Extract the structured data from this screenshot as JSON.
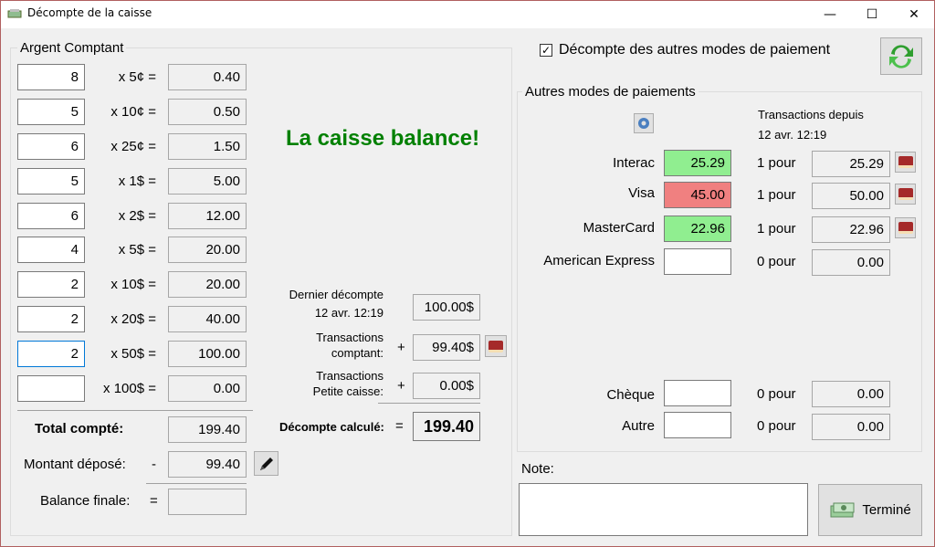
{
  "window": {
    "title": "Décompte de la caisse",
    "min_glyph": "—",
    "max_glyph": "☐",
    "close_glyph": "✕"
  },
  "cash": {
    "legend": "Argent Comptant",
    "rows": [
      {
        "qty": "8",
        "label": "x 5¢ =",
        "amount": "0.40"
      },
      {
        "qty": "5",
        "label": "x 10¢ =",
        "amount": "0.50"
      },
      {
        "qty": "6",
        "label": "x 25¢ =",
        "amount": "1.50"
      },
      {
        "qty": "5",
        "label": "x 1$ =",
        "amount": "5.00"
      },
      {
        "qty": "6",
        "label": "x 2$ =",
        "amount": "12.00"
      },
      {
        "qty": "4",
        "label": "x 5$ =",
        "amount": "20.00"
      },
      {
        "qty": "2",
        "label": "x 10$ =",
        "amount": "20.00"
      },
      {
        "qty": "2",
        "label": "x 20$ =",
        "amount": "40.00"
      },
      {
        "qty": "2",
        "label": "x 50$ =",
        "amount": "100.00"
      },
      {
        "qty": "",
        "label": "x 100$ =",
        "amount": "0.00"
      }
    ],
    "total_label": "Total compté:",
    "total_value": "199.40",
    "deposit_label": "Montant déposé:",
    "deposit_sign": "-",
    "deposit_value": "99.40",
    "final_label": "Balance finale:",
    "final_sign": "=",
    "final_value": ""
  },
  "status": {
    "message": "La caisse balance!",
    "color": "#008000"
  },
  "calc": {
    "last_label": "Dernier décompte",
    "last_date": "12 avr. 12:19",
    "last_value": "100.00$",
    "cash_tx_label_1": "Transactions",
    "cash_tx_label_2": "comptant:",
    "cash_tx_sign": "+",
    "cash_tx_value": "99.40$",
    "petty_label_1": "Transactions",
    "petty_label_2": "Petite caisse:",
    "petty_sign": "+",
    "petty_value": "0.00$",
    "computed_label": "Décompte calculé:",
    "computed_sign": "=",
    "computed_value": "199.40"
  },
  "other": {
    "checkbox_label": "Décompte des autres modes de paiement",
    "checkbox_checked": true,
    "legend": "Autres modes de paiements",
    "since_label": "Transactions depuis",
    "since_date": "12 avr. 12:19",
    "methods": [
      {
        "name": "Interac",
        "value": "25.29",
        "state": "green",
        "count": "1 pour",
        "total": "25.29",
        "has_detail": true
      },
      {
        "name": "Visa",
        "value": "45.00",
        "state": "red",
        "count": "1 pour",
        "total": "50.00",
        "has_detail": true
      },
      {
        "name": "MasterCard",
        "value": "22.96",
        "state": "green",
        "count": "1 pour",
        "total": "22.96",
        "has_detail": true
      },
      {
        "name": "American Express",
        "value": "",
        "state": "none",
        "count": "0 pour",
        "total": "0.00",
        "has_detail": false
      }
    ],
    "cheque": {
      "name": "Chèque",
      "value": "",
      "count": "0 pour",
      "total": "0.00"
    },
    "autre": {
      "name": "Autre",
      "value": "",
      "count": "0 pour",
      "total": "0.00"
    }
  },
  "note": {
    "label": "Note:",
    "value": ""
  },
  "done_button": {
    "label": "Terminé"
  },
  "colors": {
    "green_field": "#90ee90",
    "red_field": "#f08080",
    "focus_border": "#0078d7"
  }
}
